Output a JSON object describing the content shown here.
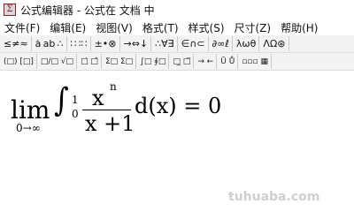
{
  "window": {
    "title": "公式编辑器 - 公式在 文档 中",
    "app_icon_glyph": "Σ"
  },
  "menu": [
    "文件(F)",
    "编辑(E)",
    "视图(V)",
    "格式(T)",
    "样式(S)",
    "尺寸(Z)",
    "帮助(H)"
  ],
  "toolbar_row1": [
    "≤≠≈",
    "ȧ ab ∴",
    "∷ ∶∷",
    "±•⊗",
    "→⇔↓",
    "∴∀∃",
    "∈∩⊂",
    "∂∞ℓ",
    "λωθ",
    "ΛΩ⊛"
  ],
  "toolbar_row2": [
    "(□) [□]",
    "□/□ √□",
    "□̇ □̂",
    "Σ□ Σ□",
    "∫□ ∮□",
    "□̲ □̅",
    "→ ←",
    "Ū Ů",
    "▫▫▫ ▦"
  ],
  "equation": {
    "lim": "lim",
    "sub": "0→∞",
    "integral": "∫",
    "upper": "1",
    "lower": "0",
    "numerator": "x",
    "exponent": "n",
    "denominator": "x +1",
    "rest": "d(x) = 0"
  },
  "watermark": "tuhuaba.com"
}
